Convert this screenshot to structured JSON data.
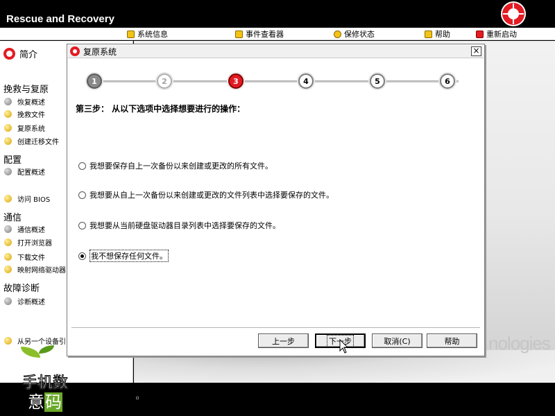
{
  "app": {
    "title": "Rescue and Recovery",
    "accent": "#e31b23"
  },
  "menubar": {
    "items": [
      {
        "label": "系统信息",
        "icon": "info-icon"
      },
      {
        "label": "事件查看器",
        "icon": "event-viewer-icon"
      },
      {
        "label": "保修状态",
        "icon": "warranty-icon"
      },
      {
        "label": "帮助",
        "icon": "help-icon"
      },
      {
        "label": "重新启动",
        "icon": "restart-icon"
      }
    ]
  },
  "sidebar": {
    "intro_label": "简介",
    "groups": [
      {
        "heading": "挽救与复原",
        "items": [
          {
            "label": "恢复概述",
            "icon": "grey-dot-icon"
          },
          {
            "label": "挽救文件",
            "icon": "yellow-dot-icon"
          },
          {
            "label": "复原系统",
            "icon": "yellow-dot-icon"
          },
          {
            "label": "创建迁移文件",
            "icon": "yellow-dot-icon"
          }
        ]
      },
      {
        "heading": "配置",
        "items": [
          {
            "label": "配置概述",
            "icon": "grey-dot-icon"
          },
          {
            "label": "访问 BIOS",
            "icon": "yellow-dot-icon"
          }
        ]
      },
      {
        "heading": "通信",
        "items": [
          {
            "label": "通信概述",
            "icon": "grey-dot-icon"
          },
          {
            "label": "打开浏览器",
            "icon": "yellow-dot-icon"
          },
          {
            "label": "下载文件",
            "icon": "yellow-dot-icon"
          },
          {
            "label": "映射网络驱动器",
            "icon": "yellow-dot-icon"
          }
        ]
      },
      {
        "heading": "故障诊断",
        "items": [
          {
            "label": "诊断概述",
            "icon": "grey-dot-icon"
          },
          {
            "label": "从另一个设备引",
            "icon": "yellow-dot-icon"
          }
        ]
      }
    ]
  },
  "dialog": {
    "title": "复原系统",
    "close_glyph": "×",
    "steps": [
      "1",
      "2",
      "3",
      "4",
      "5",
      "6"
    ],
    "current_step": 3,
    "heading": "第三步：   从以下选项中选择想要进行的操作：",
    "options": [
      {
        "label": "我想要保存自上一次备份以来创建或更改的所有文件。",
        "checked": false
      },
      {
        "label": "我想要从自上一次备份以来创建或更改的文件列表中选择要保存的文件。",
        "checked": false
      },
      {
        "label": "我想要从当前硬盘驱动器目录列表中选择要保存的文件。",
        "checked": false
      },
      {
        "label": "我不想保存任何文件。",
        "checked": true
      }
    ],
    "buttons": {
      "back": "上一步",
      "next": "下一步",
      "cancel": "取消(C)",
      "help": "帮助"
    }
  },
  "background_text": "nologies",
  "brand": {
    "top": "手机数",
    "reg": "®",
    "bottom_a": "意",
    "bottom_b": "码"
  }
}
